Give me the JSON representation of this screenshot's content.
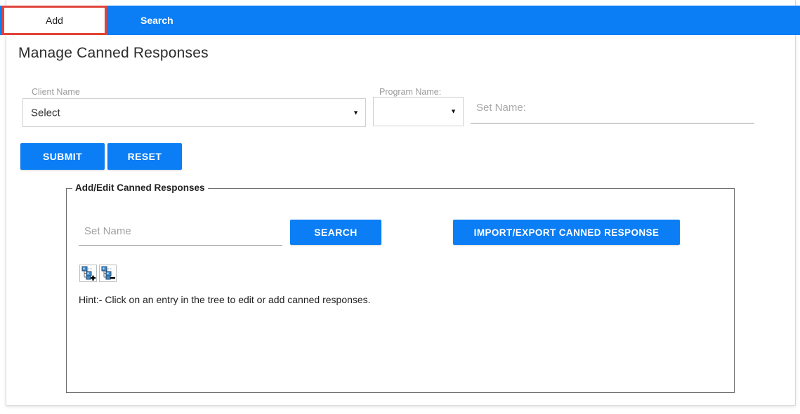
{
  "tabs": [
    {
      "label": "Add",
      "active": true
    },
    {
      "label": "Search",
      "active": false
    }
  ],
  "header": {
    "title": "Manage Canned Responses"
  },
  "form": {
    "client_name": {
      "label": "Client Name",
      "value": "Select",
      "arrow": "▼"
    },
    "program_name": {
      "label": "Program Name:",
      "value": "",
      "arrow": "▼"
    },
    "set_name": {
      "placeholder": "Set Name:",
      "value": ""
    },
    "submit_label": "SUBMIT",
    "reset_label": "RESET"
  },
  "panel": {
    "legend": "Add/Edit Canned Responses",
    "set_name": {
      "placeholder": "Set Name",
      "value": ""
    },
    "search_label": "SEARCH",
    "import_export_label": "IMPORT/EXPORT CANNED RESPONSE",
    "tree_icons": [
      {
        "name": "expand-all-tree-icon",
        "symbol": "+"
      },
      {
        "name": "collapse-all-tree-icon",
        "symbol": "−"
      }
    ],
    "hint": "Hint:- Click on an entry in the tree to edit or add canned responses."
  },
  "colors": {
    "accent_blue": "#0b7ef5",
    "highlight_red": "#e0443a",
    "label_gray": "#9a9a9a",
    "border_gray": "#6b6b6b"
  }
}
